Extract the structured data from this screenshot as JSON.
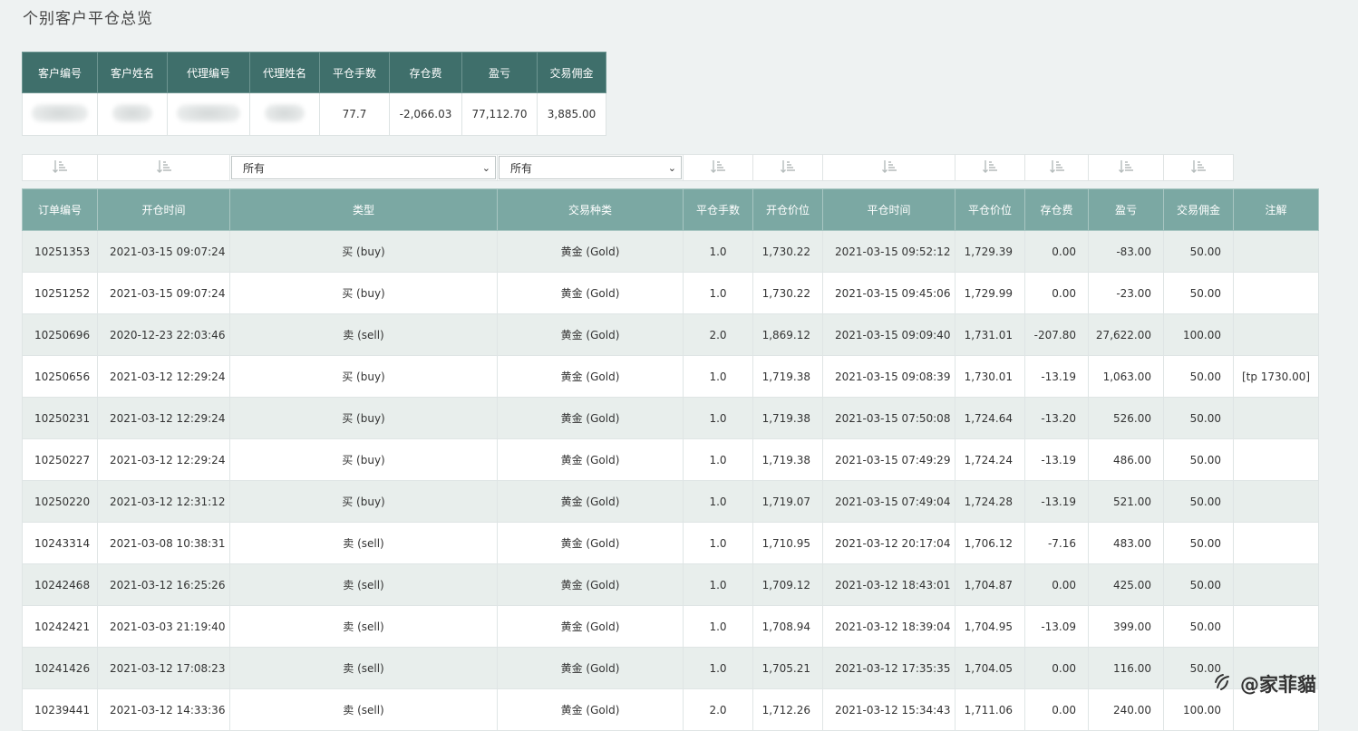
{
  "page_title": "个别客户平仓总览",
  "summary": {
    "headers": [
      "客户编号",
      "客户姓名",
      "代理编号",
      "代理姓名",
      "平仓手数",
      "存仓费",
      "盈亏",
      "交易佣金"
    ],
    "lots": "77.7",
    "storage_fee": "-2,066.03",
    "pnl": "77,112.70",
    "commission": "3,885.00"
  },
  "filters": {
    "type_select": "所有",
    "symbol_select": "所有"
  },
  "table": {
    "headers": [
      "订单编号",
      "开仓时间",
      "类型",
      "交易种类",
      "平仓手数",
      "开仓价位",
      "平仓时间",
      "平仓价位",
      "存仓费",
      "盈亏",
      "交易佣金",
      "注解"
    ],
    "rows": [
      [
        "10251353",
        "2021-03-15 09:07:24",
        "买 (buy)",
        "黄金 (Gold)",
        "1.0",
        "1,730.22",
        "2021-03-15 09:52:12",
        "1,729.39",
        "0.00",
        "-83.00",
        "50.00",
        ""
      ],
      [
        "10251252",
        "2021-03-15 09:07:24",
        "买 (buy)",
        "黄金 (Gold)",
        "1.0",
        "1,730.22",
        "2021-03-15 09:45:06",
        "1,729.99",
        "0.00",
        "-23.00",
        "50.00",
        ""
      ],
      [
        "10250696",
        "2020-12-23 22:03:46",
        "卖 (sell)",
        "黄金 (Gold)",
        "2.0",
        "1,869.12",
        "2021-03-15 09:09:40",
        "1,731.01",
        "-207.80",
        "27,622.00",
        "100.00",
        ""
      ],
      [
        "10250656",
        "2021-03-12 12:29:24",
        "买 (buy)",
        "黄金 (Gold)",
        "1.0",
        "1,719.38",
        "2021-03-15 09:08:39",
        "1,730.01",
        "-13.19",
        "1,063.00",
        "50.00",
        "[tp 1730.00]"
      ],
      [
        "10250231",
        "2021-03-12 12:29:24",
        "买 (buy)",
        "黄金 (Gold)",
        "1.0",
        "1,719.38",
        "2021-03-15 07:50:08",
        "1,724.64",
        "-13.20",
        "526.00",
        "50.00",
        ""
      ],
      [
        "10250227",
        "2021-03-12 12:29:24",
        "买 (buy)",
        "黄金 (Gold)",
        "1.0",
        "1,719.38",
        "2021-03-15 07:49:29",
        "1,724.24",
        "-13.19",
        "486.00",
        "50.00",
        ""
      ],
      [
        "10250220",
        "2021-03-12 12:31:12",
        "买 (buy)",
        "黄金 (Gold)",
        "1.0",
        "1,719.07",
        "2021-03-15 07:49:04",
        "1,724.28",
        "-13.19",
        "521.00",
        "50.00",
        ""
      ],
      [
        "10243314",
        "2021-03-08 10:38:31",
        "卖 (sell)",
        "黄金 (Gold)",
        "1.0",
        "1,710.95",
        "2021-03-12 20:17:04",
        "1,706.12",
        "-7.16",
        "483.00",
        "50.00",
        ""
      ],
      [
        "10242468",
        "2021-03-12 16:25:26",
        "卖 (sell)",
        "黄金 (Gold)",
        "1.0",
        "1,709.12",
        "2021-03-12 18:43:01",
        "1,704.87",
        "0.00",
        "425.00",
        "50.00",
        ""
      ],
      [
        "10242421",
        "2021-03-03 21:19:40",
        "卖 (sell)",
        "黄金 (Gold)",
        "1.0",
        "1,708.94",
        "2021-03-12 18:39:04",
        "1,704.95",
        "-13.09",
        "399.00",
        "50.00",
        ""
      ],
      [
        "10241426",
        "2021-03-12 17:08:23",
        "卖 (sell)",
        "黄金 (Gold)",
        "1.0",
        "1,705.21",
        "2021-03-12 17:35:35",
        "1,704.05",
        "0.00",
        "116.00",
        "50.00",
        ""
      ],
      [
        "10239441",
        "2021-03-12 14:33:36",
        "卖 (sell)",
        "黄金 (Gold)",
        "2.0",
        "1,712.26",
        "2021-03-12 15:34:43",
        "1,711.06",
        "0.00",
        "240.00",
        "100.00",
        ""
      ]
    ]
  },
  "watermark": {
    "text": "@家菲貓",
    "icon": "weibo-swirl-icon"
  },
  "colors": {
    "summary_header": "#3f6f6b",
    "table_header": "#7ba8a3",
    "striped_row": "#e8eeec",
    "background": "#eef2f2"
  }
}
